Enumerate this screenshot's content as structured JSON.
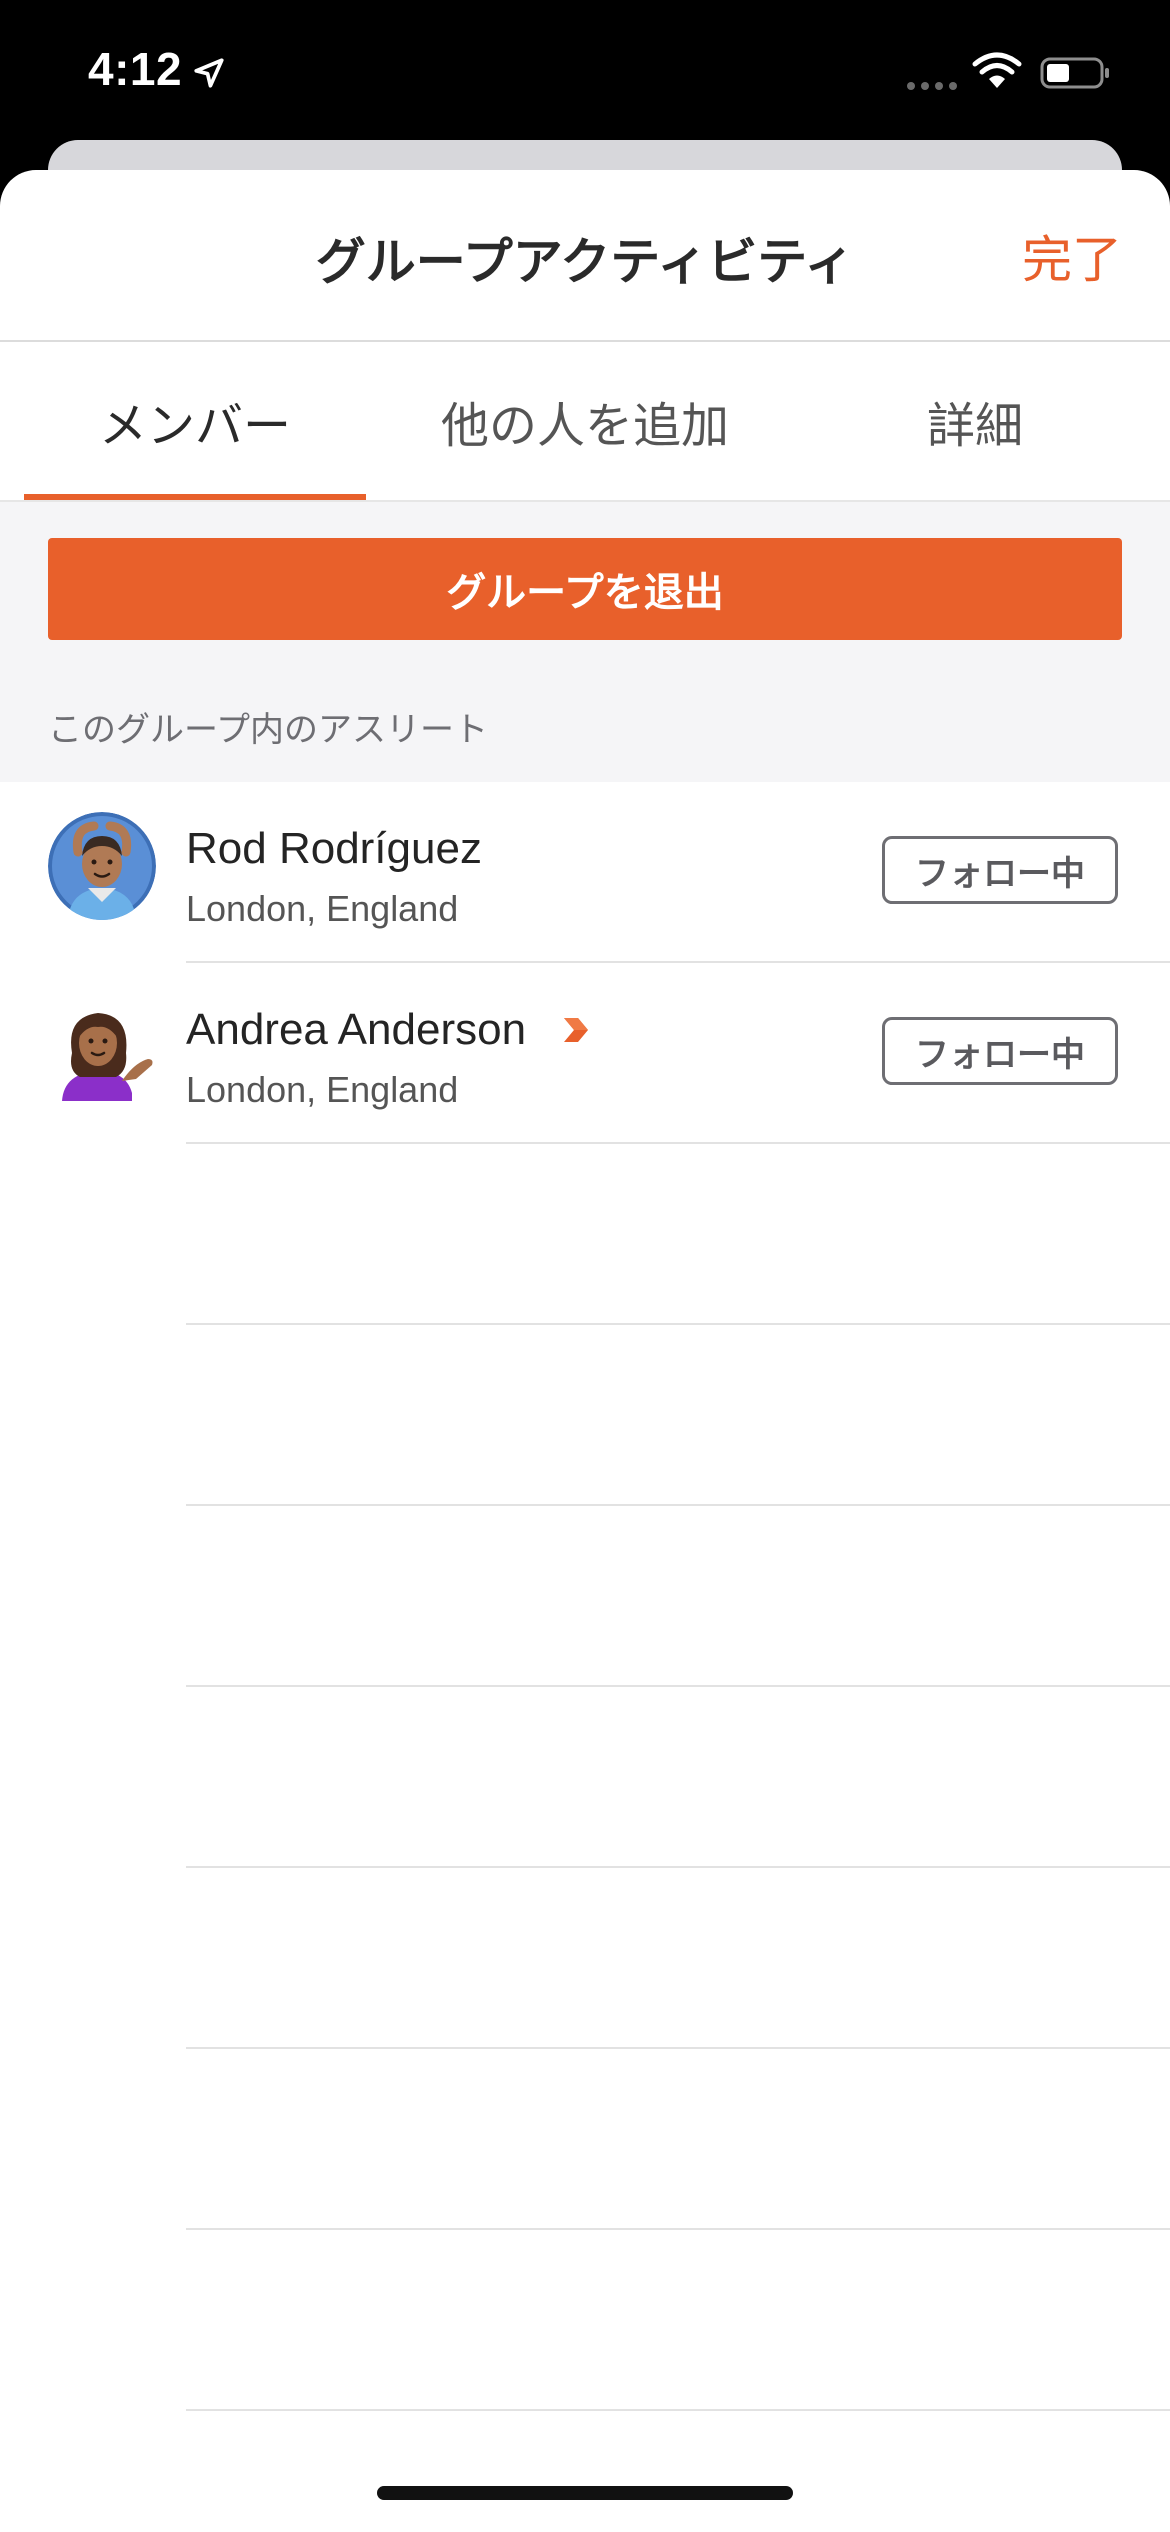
{
  "status_bar": {
    "time": "4:12"
  },
  "nav": {
    "title": "グループアクティビティ",
    "done_label": "完了"
  },
  "tabs": [
    {
      "label": "メンバー",
      "active": true
    },
    {
      "label": "他の人を追加",
      "active": false
    },
    {
      "label": "詳細",
      "active": false
    }
  ],
  "actions": {
    "leave_group_label": "グループを退出"
  },
  "section": {
    "athletes_label": "このグループ内のアスリート"
  },
  "members": [
    {
      "name": "Rod Rodríguez",
      "location": "London, England",
      "follow_label": "フォロー中",
      "subscriber_badge": false,
      "avatar_icon": "man-gesturing-ok-icon"
    },
    {
      "name": "Andrea Anderson",
      "location": "London, England",
      "follow_label": "フォロー中",
      "subscriber_badge": true,
      "avatar_icon": "woman-tipping-hand-icon"
    }
  ],
  "colors": {
    "accent": "#e8602b",
    "background_gray": "#f5f5f7",
    "text_primary": "#242424",
    "text_secondary": "#555555"
  }
}
